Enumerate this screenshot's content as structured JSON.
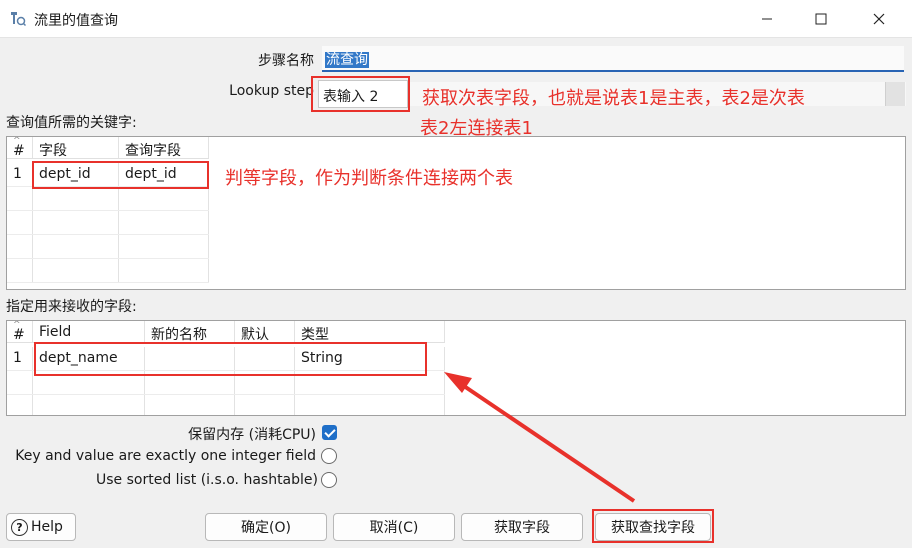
{
  "window": {
    "title": "流里的值查询"
  },
  "form": {
    "step_name_label": "步骤名称",
    "step_name_value": "流查询",
    "lookup_step_label": "Lookup step",
    "lookup_step_value": "表输入 2",
    "keys_section_label": "查询值所需的关键字:",
    "fields_section_label": "指定用来接收的字段:"
  },
  "keys_table": {
    "columns": [
      "#",
      "字段",
      "查询字段"
    ],
    "rows": [
      {
        "num": "1",
        "field": "dept_id",
        "lookup_field": "dept_id"
      }
    ]
  },
  "fields_table": {
    "columns": [
      "#",
      "Field",
      "新的名称",
      "默认",
      "类型"
    ],
    "rows": [
      {
        "num": "1",
        "field": "dept_name",
        "new_name": "",
        "default": "",
        "type": "String"
      }
    ]
  },
  "options": {
    "preserve_memory_label": "保留内存 (消耗CPU)",
    "preserve_memory_checked": true,
    "integer_key_label": "Key and value are exactly one integer field",
    "sorted_list_label": "Use sorted list (i.s.o. hashtable)"
  },
  "buttons": {
    "help": "Help",
    "ok": "确定(O)",
    "cancel": "取消(C)",
    "get_fields": "获取字段",
    "get_lookup_fields": "获取查找字段"
  },
  "annotations": {
    "lookup_note_line1": "获取次表字段，也就是说表1是主表，表2是次表",
    "lookup_note_line2": "表2左连接表1",
    "key_note": "判等字段，作为判断条件连接两个表"
  },
  "colors": {
    "annotation_red": "#e8312b",
    "accent_blue": "#1f6fc8"
  }
}
